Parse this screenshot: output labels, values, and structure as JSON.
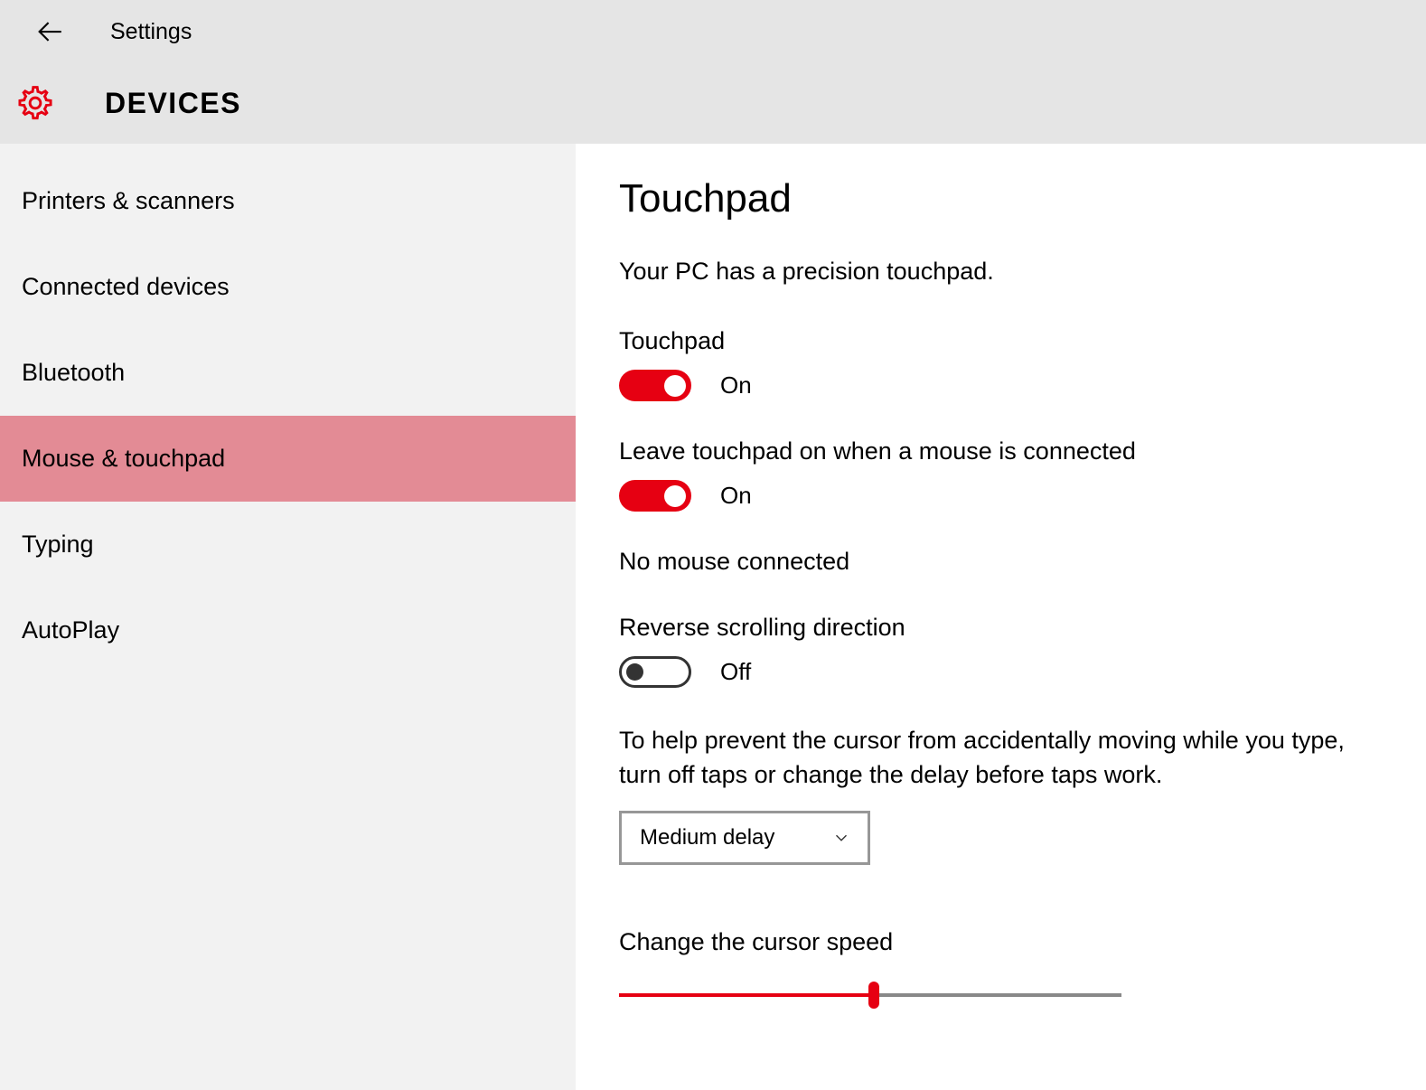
{
  "header": {
    "title": "Settings",
    "category": "DEVICES"
  },
  "sidebar": {
    "items": [
      {
        "label": "Printers & scanners",
        "selected": false
      },
      {
        "label": "Connected devices",
        "selected": false
      },
      {
        "label": "Bluetooth",
        "selected": false
      },
      {
        "label": "Mouse & touchpad",
        "selected": true
      },
      {
        "label": "Typing",
        "selected": false
      },
      {
        "label": "AutoPlay",
        "selected": false
      }
    ]
  },
  "content": {
    "heading": "Touchpad",
    "precision_text": "Your PC has a precision touchpad.",
    "touchpad_toggle": {
      "label": "Touchpad",
      "state": "On",
      "on": true
    },
    "leave_on_toggle": {
      "label": "Leave touchpad on when a mouse is connected",
      "state": "On",
      "on": true
    },
    "mouse_status": "No mouse connected",
    "reverse_toggle": {
      "label": "Reverse scrolling direction",
      "state": "Off",
      "on": false
    },
    "help_text": "To help prevent the cursor from accidentally moving while you type, turn off taps or change the delay before taps work.",
    "delay_dropdown": {
      "selected": "Medium delay"
    },
    "cursor_speed": {
      "label": "Change the cursor speed",
      "value": 50
    }
  },
  "colors": {
    "accent": "#e60012",
    "header_bg": "#e5e5e5",
    "sidebar_bg": "#f2f2f2",
    "selected_bg": "#e38b95"
  }
}
